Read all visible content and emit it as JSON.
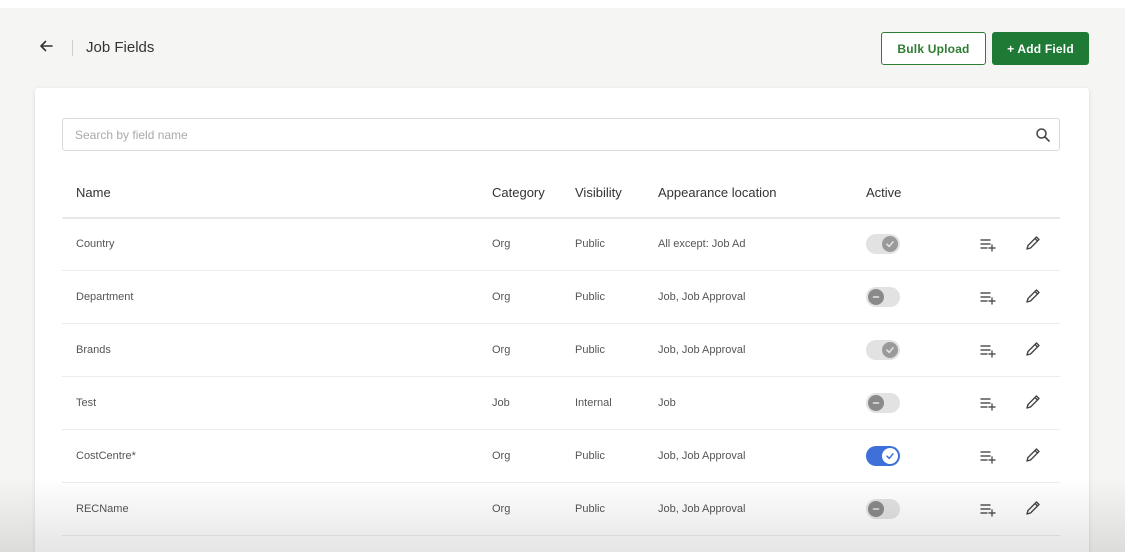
{
  "header": {
    "title": "Job Fields",
    "bulk_upload_label": "Bulk Upload",
    "add_field_label": "+ Add Field",
    "back_icon": "arrow-left-icon"
  },
  "search": {
    "placeholder": "Search by field name",
    "value": "",
    "icon": "search-icon"
  },
  "table": {
    "columns": {
      "name": "Name",
      "category": "Category",
      "visibility": "Visibility",
      "location": "Appearance location",
      "active": "Active"
    },
    "rows": [
      {
        "name": "Country",
        "category": "Org",
        "visibility": "Public",
        "location": "All except: Job Ad",
        "active": "checked-disabled"
      },
      {
        "name": "Department",
        "category": "Org",
        "visibility": "Public",
        "location": "Job, Job Approval",
        "active": "off"
      },
      {
        "name": "Brands",
        "category": "Org",
        "visibility": "Public",
        "location": "Job, Job Approval",
        "active": "checked-disabled"
      },
      {
        "name": "Test",
        "category": "Job",
        "visibility": "Internal",
        "location": "Job",
        "active": "off"
      },
      {
        "name": "CostCentre*",
        "category": "Org",
        "visibility": "Public",
        "location": "Job, Job Approval",
        "active": "on"
      },
      {
        "name": "RECName",
        "category": "Org",
        "visibility": "Public",
        "location": "Job, Job Approval",
        "active": "off"
      }
    ]
  },
  "colors": {
    "primary_green": "#1e7a35",
    "toggle_on": "#3f6fd8",
    "toggle_off": "#e2e2e2"
  },
  "icons": {
    "list_add": "playlist-add-icon",
    "edit": "pencil-icon"
  }
}
